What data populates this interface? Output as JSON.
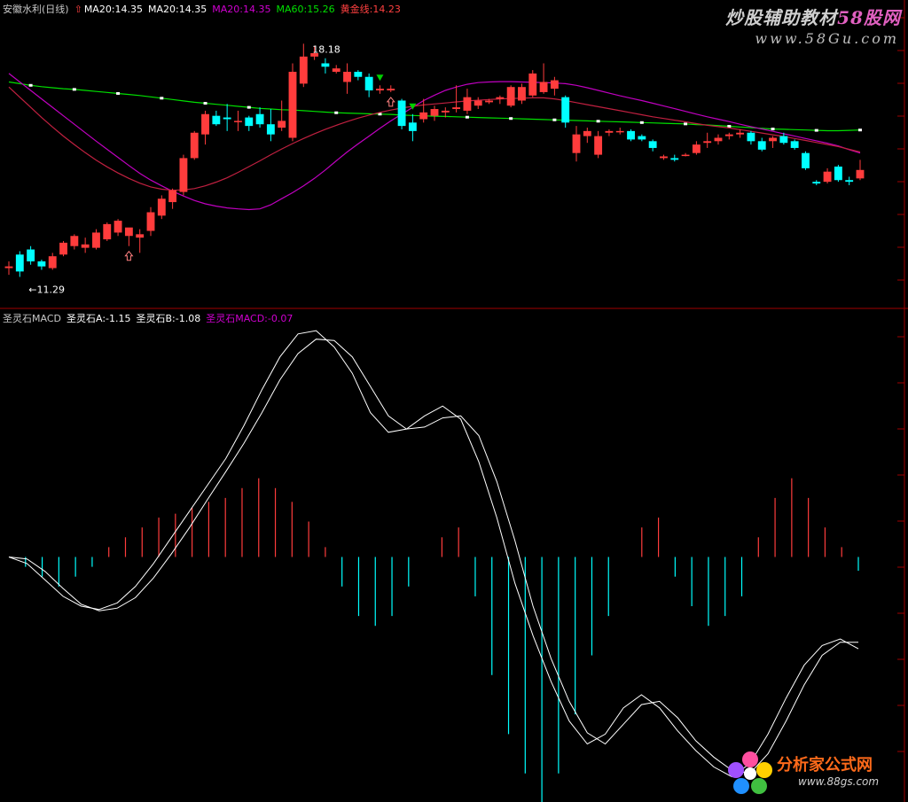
{
  "header": {
    "stock_name": "安徽水利(日线)",
    "ma20a": "MA20:14.35",
    "ma20b": "MA20:14.35",
    "ma20c": "MA20:14.35",
    "ma60": "MA60:15.26",
    "golden": "黄金线:14.23"
  },
  "indicator_header": {
    "name": "圣灵石MACD",
    "a": "圣灵石A:-1.15",
    "b": "圣灵石B:-1.08",
    "macd": "圣灵石MACD:-0.07"
  },
  "watermark": {
    "title_main": "炒股辅助教材",
    "title_accent": "58股网",
    "url": "www.58Gu.com"
  },
  "logo": {
    "text": "分析家公式网",
    "url": "www.88gs.com"
  },
  "colors": {
    "up": "#ff3c3c",
    "down": "#00ffff",
    "ma60": "#00e000",
    "ma_pink": "#c000c0",
    "ma_red": "#c02040",
    "macd_line": "#ffffff",
    "hist_pos": "#ff3c3c",
    "hist_neg": "#00ffff"
  },
  "chart_data": [
    {
      "type": "candlestick",
      "title": "安徽水利(日线)",
      "ylim": [
        10.7,
        19.0
      ],
      "annotations": [
        {
          "label": "18.18",
          "index": 27,
          "price": 18.18
        },
        {
          "label": "←11.29",
          "index": 1,
          "price": 11.29
        }
      ],
      "candles": [
        [
          11.55,
          11.75,
          11.35,
          11.6
        ],
        [
          11.95,
          12.05,
          11.29,
          11.45
        ],
        [
          12.1,
          12.2,
          11.65,
          11.75
        ],
        [
          11.75,
          11.8,
          11.5,
          11.6
        ],
        [
          11.55,
          12.0,
          11.5,
          11.9
        ],
        [
          11.95,
          12.35,
          11.9,
          12.3
        ],
        [
          12.2,
          12.55,
          12.1,
          12.5
        ],
        [
          12.15,
          12.45,
          12.0,
          12.25
        ],
        [
          12.15,
          12.7,
          12.1,
          12.6
        ],
        [
          12.4,
          12.9,
          12.35,
          12.85
        ],
        [
          12.6,
          13.0,
          12.5,
          12.95
        ],
        [
          12.5,
          12.65,
          12.2,
          12.75
        ],
        [
          12.45,
          12.7,
          12.0,
          12.55
        ],
        [
          12.65,
          13.35,
          12.5,
          13.2
        ],
        [
          13.1,
          13.7,
          13.0,
          13.6
        ],
        [
          13.5,
          13.9,
          13.3,
          13.85
        ],
        [
          13.8,
          14.9,
          13.7,
          14.8
        ],
        [
          14.8,
          15.6,
          14.75,
          15.55
        ],
        [
          15.5,
          16.2,
          15.2,
          16.1
        ],
        [
          16.05,
          16.2,
          15.75,
          15.8
        ],
        [
          16.0,
          16.4,
          15.6,
          15.95
        ],
        [
          15.9,
          16.2,
          15.6,
          15.9
        ],
        [
          16.0,
          16.05,
          15.6,
          15.75
        ],
        [
          16.1,
          16.3,
          15.7,
          15.8
        ],
        [
          15.8,
          16.25,
          15.3,
          15.5
        ],
        [
          15.7,
          16.5,
          15.6,
          15.9
        ],
        [
          15.4,
          17.6,
          15.3,
          17.35
        ],
        [
          17.0,
          18.18,
          16.9,
          17.8
        ],
        [
          17.8,
          18.1,
          17.7,
          17.9
        ],
        [
          17.6,
          17.75,
          17.3,
          17.5
        ],
        [
          17.35,
          17.55,
          17.3,
          17.45
        ],
        [
          17.05,
          17.6,
          16.7,
          17.35
        ],
        [
          17.35,
          17.4,
          17.1,
          17.2
        ],
        [
          17.2,
          17.3,
          16.6,
          16.8
        ],
        [
          16.8,
          16.95,
          16.7,
          16.85
        ],
        [
          16.8,
          16.95,
          16.75,
          16.85
        ],
        [
          16.5,
          16.55,
          15.65,
          15.75
        ],
        [
          15.85,
          16.1,
          15.3,
          15.6
        ],
        [
          15.95,
          16.55,
          15.85,
          16.15
        ],
        [
          16.05,
          16.35,
          15.9,
          16.25
        ],
        [
          16.15,
          16.3,
          16.0,
          16.2
        ],
        [
          16.25,
          16.95,
          16.15,
          16.3
        ],
        [
          16.2,
          16.85,
          16.1,
          16.6
        ],
        [
          16.35,
          16.6,
          16.25,
          16.5
        ],
        [
          16.45,
          16.55,
          16.4,
          16.5
        ],
        [
          16.55,
          16.65,
          16.4,
          16.6
        ],
        [
          16.35,
          16.95,
          16.3,
          16.9
        ],
        [
          16.5,
          17.0,
          16.4,
          16.9
        ],
        [
          16.65,
          17.4,
          16.6,
          17.3
        ],
        [
          16.75,
          17.6,
          16.7,
          17.05
        ],
        [
          16.85,
          17.2,
          16.65,
          17.1
        ],
        [
          16.6,
          16.65,
          15.7,
          15.85
        ],
        [
          14.95,
          15.75,
          14.7,
          15.5
        ],
        [
          15.45,
          15.7,
          15.25,
          15.6
        ],
        [
          14.9,
          15.6,
          14.8,
          15.45
        ],
        [
          15.55,
          15.65,
          15.45,
          15.6
        ],
        [
          15.6,
          15.7,
          15.5,
          15.6
        ],
        [
          15.6,
          15.65,
          15.3,
          15.35
        ],
        [
          15.45,
          15.5,
          15.3,
          15.35
        ],
        [
          15.3,
          15.35,
          15.0,
          15.1
        ],
        [
          14.8,
          14.9,
          14.75,
          14.85
        ],
        [
          14.8,
          14.9,
          14.7,
          14.75
        ],
        [
          14.9,
          14.95,
          14.85,
          14.9
        ],
        [
          14.95,
          15.3,
          14.9,
          15.2
        ],
        [
          15.25,
          15.55,
          15.1,
          15.3
        ],
        [
          15.3,
          15.5,
          15.2,
          15.4
        ],
        [
          15.45,
          15.55,
          15.35,
          15.5
        ],
        [
          15.5,
          15.65,
          15.4,
          15.55
        ],
        [
          15.55,
          15.6,
          15.2,
          15.3
        ],
        [
          15.3,
          15.4,
          15.0,
          15.05
        ],
        [
          15.3,
          15.45,
          15.1,
          15.4
        ],
        [
          15.45,
          15.55,
          15.2,
          15.25
        ],
        [
          15.3,
          15.35,
          15.05,
          15.1
        ],
        [
          14.95,
          15.0,
          14.45,
          14.5
        ],
        [
          14.1,
          14.15,
          14.0,
          14.05
        ],
        [
          14.1,
          14.5,
          14.05,
          14.4
        ],
        [
          14.55,
          14.6,
          14.1,
          14.15
        ],
        [
          14.15,
          14.25,
          14.0,
          14.1
        ],
        [
          14.2,
          14.75,
          14.15,
          14.45
        ]
      ],
      "series": [
        {
          "name": "MA60",
          "values": [
            17.05,
            17.0,
            16.95,
            16.91,
            16.88,
            16.85,
            16.83,
            16.8,
            16.77,
            16.74,
            16.71,
            16.68,
            16.65,
            16.61,
            16.57,
            16.53,
            16.49,
            16.45,
            16.42,
            16.39,
            16.36,
            16.33,
            16.3,
            16.27,
            16.25,
            16.23,
            16.22,
            16.2,
            16.18,
            16.16,
            16.14,
            16.13,
            16.12,
            16.11,
            16.1,
            16.09,
            16.07,
            16.06,
            16.05,
            16.04,
            16.03,
            16.02,
            16.01,
            16.0,
            15.99,
            15.98,
            15.97,
            15.96,
            15.95,
            15.94,
            15.93,
            15.92,
            15.91,
            15.9,
            15.89,
            15.88,
            15.87,
            15.86,
            15.85,
            15.84,
            15.83,
            15.82,
            15.81,
            15.79,
            15.78,
            15.76,
            15.74,
            15.72,
            15.7,
            15.68,
            15.66,
            15.65,
            15.64,
            15.63,
            15.62,
            15.61,
            15.61,
            15.62,
            15.63
          ]
        },
        {
          "name": "MA20",
          "values": [
            17.3,
            17.05,
            16.8,
            16.55,
            16.3,
            16.05,
            15.8,
            15.55,
            15.3,
            15.06,
            14.82,
            14.58,
            14.35,
            14.15,
            13.98,
            13.82,
            13.68,
            13.55,
            13.45,
            13.38,
            13.33,
            13.3,
            13.28,
            13.3,
            13.42,
            13.6,
            13.78,
            13.98,
            14.2,
            14.45,
            14.72,
            14.98,
            15.22,
            15.45,
            15.68,
            15.9,
            16.1,
            16.3,
            16.5,
            16.66,
            16.8,
            16.9,
            16.98,
            17.03,
            17.05,
            17.06,
            17.06,
            17.05,
            17.04,
            17.03,
            17.02,
            17.0,
            16.95,
            16.88,
            16.8,
            16.72,
            16.64,
            16.57,
            16.5,
            16.42,
            16.34,
            16.26,
            16.18,
            16.1,
            16.02,
            15.95,
            15.88,
            15.8,
            15.73,
            15.66,
            15.59,
            15.52,
            15.45,
            15.38,
            15.31,
            15.24,
            15.16,
            15.05,
            14.95
          ]
        },
        {
          "name": "MA20",
          "values": [
            16.9,
            16.6,
            16.3,
            16.0,
            15.72,
            15.45,
            15.2,
            14.96,
            14.74,
            14.54,
            14.36,
            14.2,
            14.06,
            13.95,
            13.88,
            13.85,
            13.86,
            13.9,
            13.98,
            14.09,
            14.22,
            14.38,
            14.55,
            14.72,
            14.9,
            15.07,
            15.23,
            15.38,
            15.52,
            15.65,
            15.77,
            15.88,
            15.98,
            16.07,
            16.15,
            16.22,
            16.28,
            16.33,
            16.37,
            16.4,
            16.43,
            16.46,
            16.49,
            16.51,
            16.53,
            16.55,
            16.56,
            16.57,
            16.58,
            16.58,
            16.55,
            16.5,
            16.44,
            16.38,
            16.32,
            16.26,
            16.2,
            16.14,
            16.08,
            16.02,
            15.97,
            15.92,
            15.87,
            15.82,
            15.77,
            15.73,
            15.69,
            15.64,
            15.59,
            15.54,
            15.49,
            15.44,
            15.38,
            15.32,
            15.26,
            15.2,
            15.14,
            15.06,
            14.98
          ]
        }
      ],
      "markers": [
        {
          "type": "up-arrow",
          "index": 11
        },
        {
          "type": "down-arrow",
          "index": 34
        },
        {
          "type": "down-arrow",
          "index": 37
        },
        {
          "type": "up-arrow",
          "index": 35
        }
      ]
    },
    {
      "type": "line",
      "title": "圣灵石MACD",
      "ylim": [
        -3.6,
        3.6
      ],
      "series": [
        {
          "name": "圣灵石A",
          "values": [
            0.0,
            -0.1,
            -0.35,
            -0.6,
            -0.75,
            -0.8,
            -0.7,
            -0.45,
            -0.1,
            0.3,
            0.7,
            1.1,
            1.5,
            2.0,
            2.55,
            3.05,
            3.4,
            3.45,
            3.2,
            2.8,
            2.2,
            1.9,
            1.95,
            2.15,
            2.3,
            2.1,
            1.45,
            0.6,
            -0.4,
            -1.2,
            -1.9,
            -2.5,
            -2.85,
            -2.7,
            -2.3,
            -2.1,
            -2.3,
            -2.65,
            -2.95,
            -3.2,
            -3.35,
            -3.15,
            -2.7,
            -2.15,
            -1.65,
            -1.35,
            -1.25,
            -1.4
          ]
        },
        {
          "name": "圣灵石B",
          "values": [
            0.0,
            -0.03,
            -0.22,
            -0.48,
            -0.72,
            -0.82,
            -0.78,
            -0.62,
            -0.32,
            0.05,
            0.45,
            0.88,
            1.3,
            1.73,
            2.2,
            2.7,
            3.1,
            3.32,
            3.3,
            3.05,
            2.6,
            2.15,
            1.95,
            1.98,
            2.12,
            2.15,
            1.85,
            1.15,
            0.25,
            -0.75,
            -1.55,
            -2.2,
            -2.68,
            -2.85,
            -2.55,
            -2.25,
            -2.2,
            -2.45,
            -2.8,
            -3.05,
            -3.25,
            -3.3,
            -3.0,
            -2.5,
            -1.95,
            -1.5,
            -1.3,
            -1.3
          ]
        },
        {
          "name": "圣灵石MACD",
          "values": [
            0.0,
            -0.05,
            -0.1,
            -0.15,
            -0.1,
            -0.05,
            0.05,
            0.1,
            0.15,
            0.2,
            0.22,
            0.25,
            0.28,
            0.3,
            0.35,
            0.4,
            0.35,
            0.28,
            0.18,
            0.05,
            -0.15,
            -0.3,
            -0.35,
            -0.3,
            -0.15,
            0.0,
            0.1,
            0.15,
            -0.2,
            -0.6,
            -0.9,
            -1.1,
            -1.3,
            -1.1,
            -0.8,
            -0.5,
            -0.3,
            0.0,
            0.15,
            0.2,
            -0.1,
            -0.25,
            -0.35,
            -0.3,
            -0.2,
            0.1,
            0.3,
            0.4,
            0.3,
            0.15,
            0.05,
            -0.07
          ]
        }
      ]
    }
  ]
}
